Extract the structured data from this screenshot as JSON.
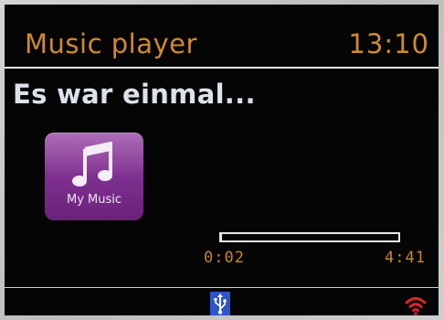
{
  "header": {
    "title": "Music player",
    "time": "13:10"
  },
  "track": {
    "title": "Es war einmal..."
  },
  "source": {
    "label": "My Music",
    "icon": "music-note-icon",
    "color": "#7d2e8e"
  },
  "playback": {
    "elapsed": "0:02",
    "total": "4:41",
    "progress_fraction": 0.007
  },
  "status_bar": {
    "usb_icon": "usb-icon",
    "wifi_icon": "wifi-signal-icon",
    "wifi_color": "#d8232a"
  },
  "colors": {
    "accent": "#d08a2e",
    "text": "#dde2ea",
    "background": "#050505"
  }
}
